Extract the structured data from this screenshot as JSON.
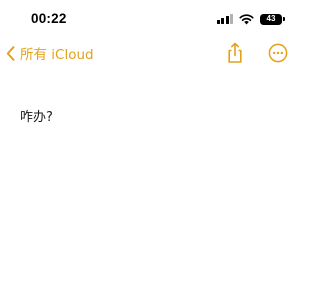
{
  "status_bar": {
    "time": "00:22",
    "battery_level": "43",
    "icons": [
      "signal-icon",
      "wifi-icon",
      "battery-icon"
    ]
  },
  "nav": {
    "back_label": "所有 iCloud",
    "back_icon": "chevron-left-icon",
    "share_icon": "share-icon",
    "more_icon": "ellipsis-circle-icon",
    "accent_color": "#e3a21a"
  },
  "note": {
    "text": "咋办?"
  }
}
